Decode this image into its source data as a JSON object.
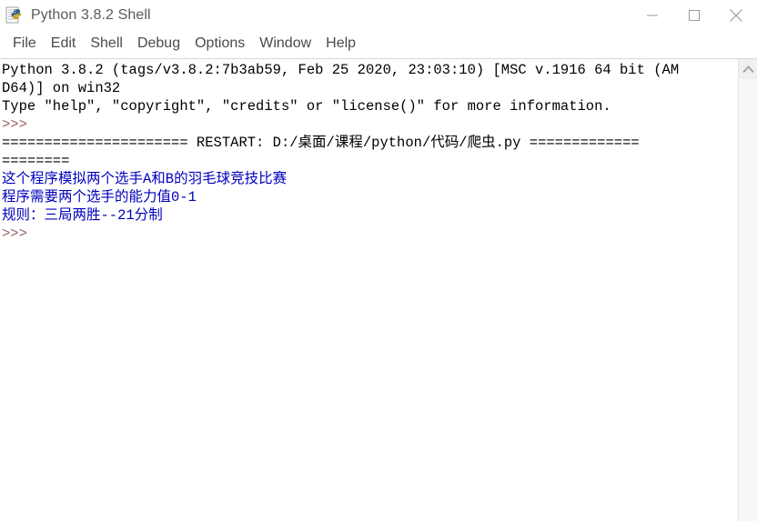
{
  "window": {
    "title": "Python 3.8.2 Shell",
    "icon": "python-idle-icon",
    "controls": {
      "minimize_label": "—",
      "maximize_label": "☐",
      "close_label": "✕"
    }
  },
  "menubar": {
    "items": [
      {
        "label": "File",
        "name": "menu-file"
      },
      {
        "label": "Edit",
        "name": "menu-edit"
      },
      {
        "label": "Shell",
        "name": "menu-shell"
      },
      {
        "label": "Debug",
        "name": "menu-debug"
      },
      {
        "label": "Options",
        "name": "menu-options"
      },
      {
        "label": "Window",
        "name": "menu-window"
      },
      {
        "label": "Help",
        "name": "menu-help"
      }
    ]
  },
  "shell": {
    "lines": [
      {
        "kind": "stdin",
        "text": "Python 3.8.2 (tags/v3.8.2:7b3ab59, Feb 25 2020, 23:03:10) [MSC v.1916 64 bit (AM"
      },
      {
        "kind": "stdin",
        "text": "D64)] on win32"
      },
      {
        "kind": "stdin",
        "text": "Type \"help\", \"copyright\", \"credits\" or \"license()\" for more information."
      },
      {
        "kind": "prompt",
        "text": ">>> "
      },
      {
        "kind": "restart",
        "text": "====================== RESTART: D:/桌面/课程/python/代码/爬虫.py ============="
      },
      {
        "kind": "restart",
        "text": "========"
      },
      {
        "kind": "stdout",
        "text": "这个程序模拟两个选手A和B的羽毛球竞技比赛"
      },
      {
        "kind": "stdout",
        "text": "程序需要两个选手的能力值0-1"
      },
      {
        "kind": "stdout",
        "text": "规则：三局两胜--21分制"
      },
      {
        "kind": "prompt",
        "text": ">>> "
      }
    ],
    "colors": {
      "stdin": "#000000",
      "stdout": "#0000bb",
      "prompt": "#a06060",
      "restart": "#000000",
      "background": "#ffffff"
    }
  },
  "scrollbar": {
    "up_arrow": "chevron-up-icon",
    "orientation": "vertical"
  }
}
